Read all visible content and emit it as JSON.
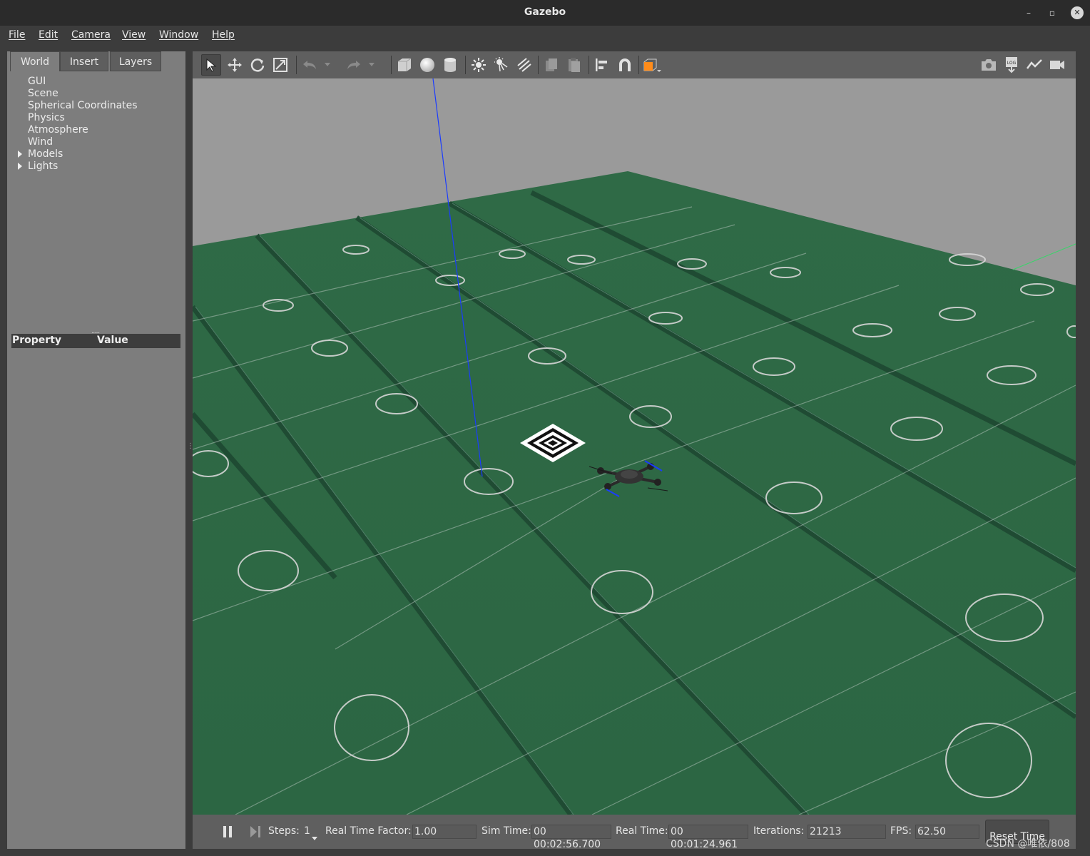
{
  "window": {
    "title": "Gazebo"
  },
  "menu": [
    "File",
    "Edit",
    "Camera",
    "View",
    "Window",
    "Help"
  ],
  "left_panel": {
    "tabs": [
      "World",
      "Insert",
      "Layers"
    ],
    "active_tab": "World",
    "tree": [
      {
        "label": "GUI",
        "expandable": false
      },
      {
        "label": "Scene",
        "expandable": false
      },
      {
        "label": "Spherical Coordinates",
        "expandable": false
      },
      {
        "label": "Physics",
        "expandable": false
      },
      {
        "label": "Atmosphere",
        "expandable": false
      },
      {
        "label": "Wind",
        "expandable": false
      },
      {
        "label": "Models",
        "expandable": true
      },
      {
        "label": "Lights",
        "expandable": true
      }
    ],
    "property_header": {
      "property": "Property",
      "value": "Value"
    }
  },
  "toolbar": {
    "tools": [
      "select-arrow-icon",
      "translate-icon",
      "rotate-icon",
      "scale-icon",
      "undo-icon",
      "redo-icon",
      "box-icon",
      "sphere-icon",
      "cylinder-icon",
      "point-light-icon",
      "spot-light-icon",
      "directional-light-icon",
      "copy-icon",
      "paste-icon",
      "align-icon",
      "snap-magnet-icon",
      "view-angle-icon"
    ],
    "right_tools": [
      "screenshot-camera-icon",
      "log-icon",
      "plot-icon",
      "video-record-icon"
    ]
  },
  "status": {
    "steps_label": "Steps:",
    "steps_value": "1",
    "rtf_label": "Real Time Factor:",
    "rtf_value": "1.00",
    "sim_time_label": "Sim Time:",
    "sim_time_value": "00 00:02:56.700",
    "real_time_label": "Real Time:",
    "real_time_value": "00 00:01:24.961",
    "iterations_label": "Iterations:",
    "iterations_value": "21213",
    "fps_label": "FPS:",
    "fps_value": "62.50",
    "reset_label": "Reset Time"
  },
  "watermark": "CSDN @唯依/808",
  "colors": {
    "ground": "#2f6b45",
    "sky": "#9a9a9a",
    "panel": "#7d7d7d",
    "toolbar": "#5f5f5f"
  }
}
